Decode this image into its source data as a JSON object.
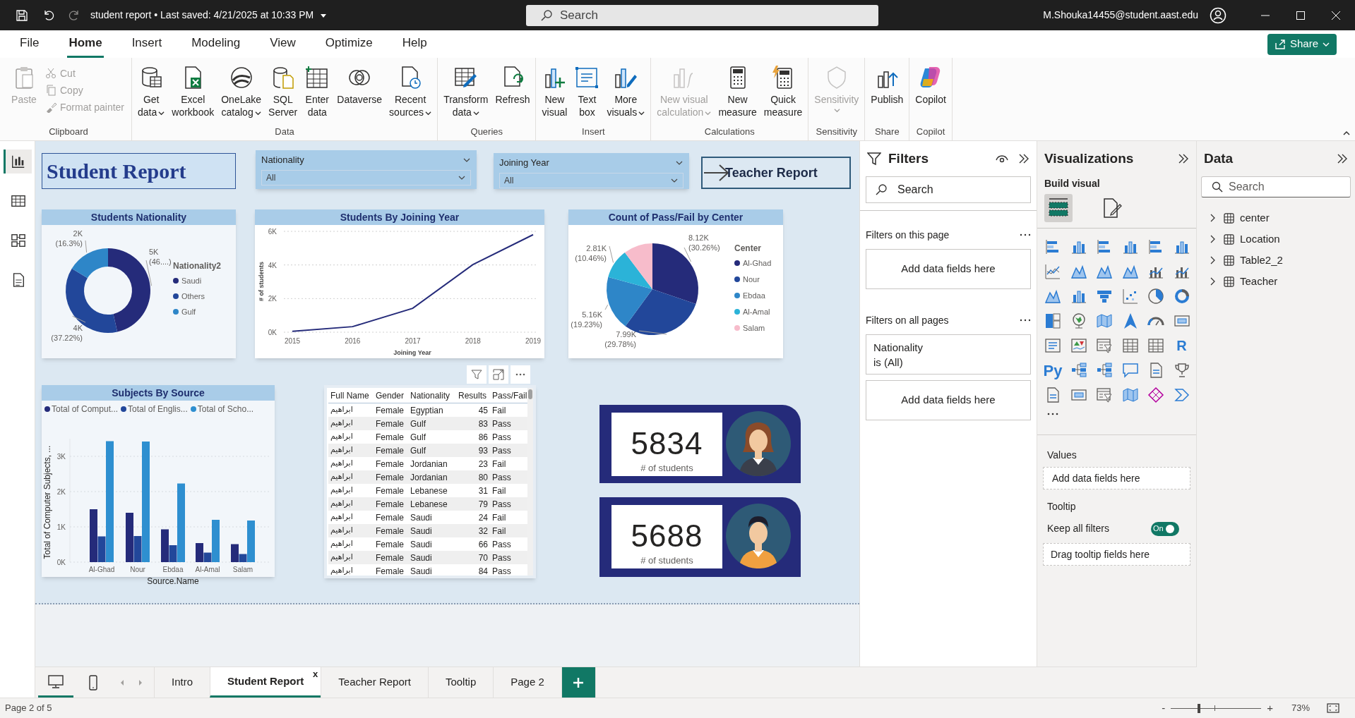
{
  "title_bar": {
    "file_status": "student report • Last saved: 4/21/2025 at 10:33 PM",
    "search_placeholder": "Search",
    "account": "M.Shouka14455@student.aast.edu"
  },
  "menu_tabs": [
    {
      "label": "File",
      "selected": false
    },
    {
      "label": "Home",
      "selected": true
    },
    {
      "label": "Insert",
      "selected": false
    },
    {
      "label": "Modeling",
      "selected": false
    },
    {
      "label": "View",
      "selected": false
    },
    {
      "label": "Optimize",
      "selected": false
    },
    {
      "label": "Help",
      "selected": false
    }
  ],
  "share_button": "Share",
  "ribbon": [
    {
      "label": "Clipboard",
      "buttons": [
        {
          "label": "Paste",
          "kind": "large",
          "disabled": true,
          "menu": false
        },
        {
          "label": "Cut",
          "kind": "small",
          "disabled": true,
          "menu": false
        },
        {
          "label": "Copy",
          "kind": "small",
          "disabled": true,
          "menu": false
        },
        {
          "label": "Format painter",
          "kind": "small",
          "disabled": true,
          "menu": false
        }
      ]
    },
    {
      "label": "Data",
      "buttons": [
        {
          "label": "Get\ndata",
          "kind": "large",
          "disabled": false,
          "menu": true
        },
        {
          "label": "Excel\nworkbook",
          "kind": "large",
          "disabled": false,
          "menu": false
        },
        {
          "label": "OneLake\ncatalog",
          "kind": "large",
          "disabled": false,
          "menu": true
        },
        {
          "label": "SQL\nServer",
          "kind": "large",
          "disabled": false,
          "menu": false
        },
        {
          "label": "Enter\ndata",
          "kind": "large",
          "disabled": false,
          "menu": false
        },
        {
          "label": "Dataverse",
          "kind": "large",
          "disabled": false,
          "menu": false
        },
        {
          "label": "Recent\nsources",
          "kind": "large",
          "disabled": false,
          "menu": true
        }
      ]
    },
    {
      "label": "Queries",
      "buttons": [
        {
          "label": "Transform\ndata",
          "kind": "large",
          "disabled": false,
          "menu": true
        },
        {
          "label": "Refresh",
          "kind": "large",
          "disabled": false,
          "menu": false
        }
      ]
    },
    {
      "label": "Insert",
      "buttons": [
        {
          "label": "New\nvisual",
          "kind": "large",
          "disabled": false,
          "menu": false
        },
        {
          "label": "Text\nbox",
          "kind": "large",
          "disabled": false,
          "menu": false
        },
        {
          "label": "More\nvisuals",
          "kind": "large",
          "disabled": false,
          "menu": true
        }
      ]
    },
    {
      "label": "Calculations",
      "buttons": [
        {
          "label": "New visual\ncalculation",
          "kind": "large",
          "disabled": true,
          "menu": true
        },
        {
          "label": "New\nmeasure",
          "kind": "large",
          "disabled": false,
          "menu": false
        },
        {
          "label": "Quick\nmeasure",
          "kind": "large",
          "disabled": false,
          "menu": false
        }
      ]
    },
    {
      "label": "Sensitivity",
      "buttons": [
        {
          "label": "Sensitivity",
          "kind": "large",
          "disabled": true,
          "menu": true
        }
      ]
    },
    {
      "label": "Share",
      "buttons": [
        {
          "label": "Publish",
          "kind": "large",
          "disabled": false,
          "menu": false
        }
      ]
    },
    {
      "label": "Copilot",
      "buttons": [
        {
          "label": "Copilot",
          "kind": "large",
          "disabled": false,
          "menu": false
        }
      ]
    }
  ],
  "left_nav": [
    {
      "selected": true
    },
    {
      "selected": false
    },
    {
      "selected": false
    },
    {
      "selected": false
    }
  ],
  "report": {
    "title": "Student Report",
    "slicers": [
      {
        "label": "Nationality",
        "value": "All"
      },
      {
        "label": "Joining Year",
        "value": "All"
      }
    ],
    "nav_button": "Teacher Report",
    "nationality_chart": {
      "slices": [
        {
          "color": "#252b7a"
        },
        {
          "color": "#22479a"
        },
        {
          "color": "#2e86c8"
        }
      ],
      "chart_data": {
        "type": "donut",
        "title": "Students Nationality",
        "categories": [
          "Saudi",
          "Others",
          "Gulf"
        ],
        "values": [
          46.48,
          37.22,
          16.3
        ],
        "value_labels": [
          "5K (46....)",
          "4K (37.22%)",
          "2K (16.3%)"
        ],
        "legend": {
          "title": "Nationality2"
        }
      }
    },
    "joining_year_chart": {
      "chart_data": {
        "type": "line",
        "title": "Students By Joining Year",
        "xlabel": "Joining Year",
        "ylabel": "# of students",
        "x": [
          "2015",
          "2016",
          "2017",
          "2018",
          "2019"
        ],
        "values": [
          50,
          330,
          1420,
          4020,
          5800
        ],
        "ylim": [
          0,
          6000
        ],
        "grid": true,
        "yticks": [
          {
            "value": 0,
            "label": "0K"
          },
          {
            "value": 2000,
            "label": "2K"
          },
          {
            "value": 4000,
            "label": "4K"
          },
          {
            "value": 6000,
            "label": "6K"
          }
        ]
      }
    },
    "pass_fail_chart": {
      "slices": [
        {
          "color": "#252b7a"
        },
        {
          "color": "#22479a"
        },
        {
          "color": "#2e86c8"
        },
        {
          "color": "#2bb3d8"
        },
        {
          "color": "#f7bccb"
        }
      ],
      "chart_data": {
        "type": "pie",
        "title": "Count of Pass/Fail by Center",
        "categories": [
          "Al-Ghad",
          "Nour",
          "Ebdaa",
          "Al-Amal",
          "Salam"
        ],
        "values": [
          8120,
          7990,
          5160,
          2810,
          2760
        ],
        "value_labels": [
          "8.12K (30.26%)",
          "7.99K (29.78%)",
          "5.16K (19.23%)",
          "2.81K (10.46%)",
          null
        ],
        "legend": {
          "title": "Center"
        }
      }
    },
    "source_chart": {
      "chart_data": {
        "type": "bar",
        "title": "Subjects By Source",
        "xlabel": "Source.Name",
        "ylabel": "Total of Computer Subjects, ...",
        "categories": [
          "Al-Ghad",
          "Nour",
          "Ebdaa",
          "Al-Amal",
          "Salam"
        ],
        "series": [
          {
            "name": "Total of Comput...",
            "color": "#252b7a",
            "values": [
              1500,
              1400,
              930,
              540,
              510
            ]
          },
          {
            "name": "Total of Englis...",
            "color": "#22479a",
            "values": [
              730,
              740,
              480,
              270,
              230
            ]
          },
          {
            "name": "Total of Scho...",
            "color": "#2e8fd0",
            "values": [
              3430,
              3420,
              2230,
              1200,
              1180
            ]
          }
        ],
        "grid": true,
        "ylim": [
          0,
          3500
        ],
        "yticks": [
          {
            "value": 0,
            "label": "0K"
          },
          {
            "value": 1000,
            "label": "1K"
          },
          {
            "value": 2000,
            "label": "2K"
          },
          {
            "value": 3000,
            "label": "3K"
          }
        ]
      }
    },
    "students_table": {
      "columns": [
        "Full Name",
        "Gender",
        "Nationality",
        "Results",
        "Pass/Fail"
      ],
      "rows": [
        [
          "ابراهيم",
          "Female",
          "Egyptian",
          "45",
          "Fail"
        ],
        [
          "ابراهيم",
          "Female",
          "Gulf",
          "83",
          "Pass"
        ],
        [
          "ابراهيم",
          "Female",
          "Gulf",
          "86",
          "Pass"
        ],
        [
          "ابراهيم",
          "Female",
          "Gulf",
          "93",
          "Pass"
        ],
        [
          "ابراهيم",
          "Female",
          "Jordanian",
          "23",
          "Fail"
        ],
        [
          "ابراهيم",
          "Female",
          "Jordanian",
          "80",
          "Pass"
        ],
        [
          "ابراهيم",
          "Female",
          "Lebanese",
          "31",
          "Fail"
        ],
        [
          "ابراهيم",
          "Female",
          "Lebanese",
          "79",
          "Pass"
        ],
        [
          "ابراهيم",
          "Female",
          "Saudi",
          "24",
          "Fail"
        ],
        [
          "ابراهيم",
          "Female",
          "Saudi",
          "32",
          "Fail"
        ],
        [
          "ابراهيم",
          "Female",
          "Saudi",
          "66",
          "Pass"
        ],
        [
          "ابراهيم",
          "Female",
          "Saudi",
          "70",
          "Pass"
        ],
        [
          "ابراهيم",
          "Female",
          "Saudi",
          "84",
          "Pass"
        ]
      ]
    },
    "cards": [
      {
        "value": "5834",
        "label": "# of students"
      },
      {
        "value": "5688",
        "label": "# of students"
      }
    ]
  },
  "filters_pane": {
    "title": "Filters",
    "search_placeholder": "Search",
    "sections": [
      {
        "label": "Filters on this page",
        "cards": [
          {
            "kind": "well",
            "text": "Add data fields here"
          }
        ]
      },
      {
        "label": "Filters on all pages",
        "cards": [
          {
            "kind": "filter",
            "field": "Nationality",
            "condition": "is (All)"
          },
          {
            "kind": "well",
            "text": "Add data fields here"
          }
        ]
      }
    ]
  },
  "visualizations_pane": {
    "title": "Visualizations",
    "subtitle": "Build visual",
    "modes": [
      {
        "selected": true
      },
      {
        "selected": false
      }
    ],
    "script_labels": [
      "R",
      "Py"
    ],
    "values_label": "Values",
    "values_well": "Add data fields here",
    "tooltip_label": "Tooltip",
    "keep_filters": {
      "label": "Keep all filters",
      "on": true,
      "text": "On"
    },
    "tooltip_well": "Drag tooltip fields here"
  },
  "data_pane": {
    "title": "Data",
    "search_placeholder": "Search",
    "tables": [
      {
        "name": "center",
        "expanded": false
      },
      {
        "name": "Location",
        "expanded": false
      },
      {
        "name": "Table2_2",
        "expanded": false
      },
      {
        "name": "Teacher",
        "expanded": false
      }
    ]
  },
  "page_tabs": [
    {
      "label": "Intro",
      "selected": false
    },
    {
      "label": "Student Report",
      "selected": true
    },
    {
      "label": "Teacher Report",
      "selected": false
    },
    {
      "label": "Tooltip",
      "selected": false
    },
    {
      "label": "Page 2",
      "selected": false
    }
  ],
  "page_tab_close": "x",
  "status_bar": {
    "page": "Page 2 of 5",
    "zoom_out": "-",
    "zoom_in": "+",
    "zoom": "73%",
    "level": 0.31
  }
}
